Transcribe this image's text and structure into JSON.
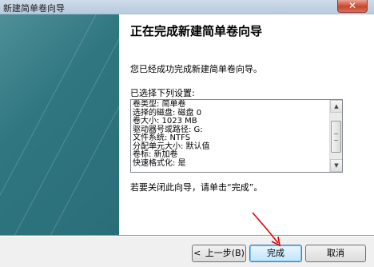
{
  "window": {
    "title": "新建简单卷向导",
    "close_glyph": "✕"
  },
  "content": {
    "heading": "正在完成新建简单卷向导",
    "success_message": "您已经成功完成新建简单卷向导。",
    "settings_label": "已选择下列设置:",
    "summary_lines": [
      "卷类型: 简单卷",
      "选择的磁盘: 磁盘 0",
      "卷大小: 1023 MB",
      "驱动器号或路径: G:",
      "文件系统: NTFS",
      "分配单元大小: 默认值",
      "卷标: 新加卷",
      "快速格式化: 是"
    ],
    "close_instruction": "若要关闭此向导，请单击“完成”。"
  },
  "buttons": {
    "back_arrow": "<",
    "back_label": " 上一步(B)",
    "finish_label": "完成",
    "cancel_label": "取消"
  },
  "scrollbar": {
    "up_glyph": "▲",
    "down_glyph": "▼"
  },
  "colors": {
    "banner": "#2f7680",
    "annotation_arrow": "#e00000",
    "finish_border": "#3c7fb1"
  }
}
